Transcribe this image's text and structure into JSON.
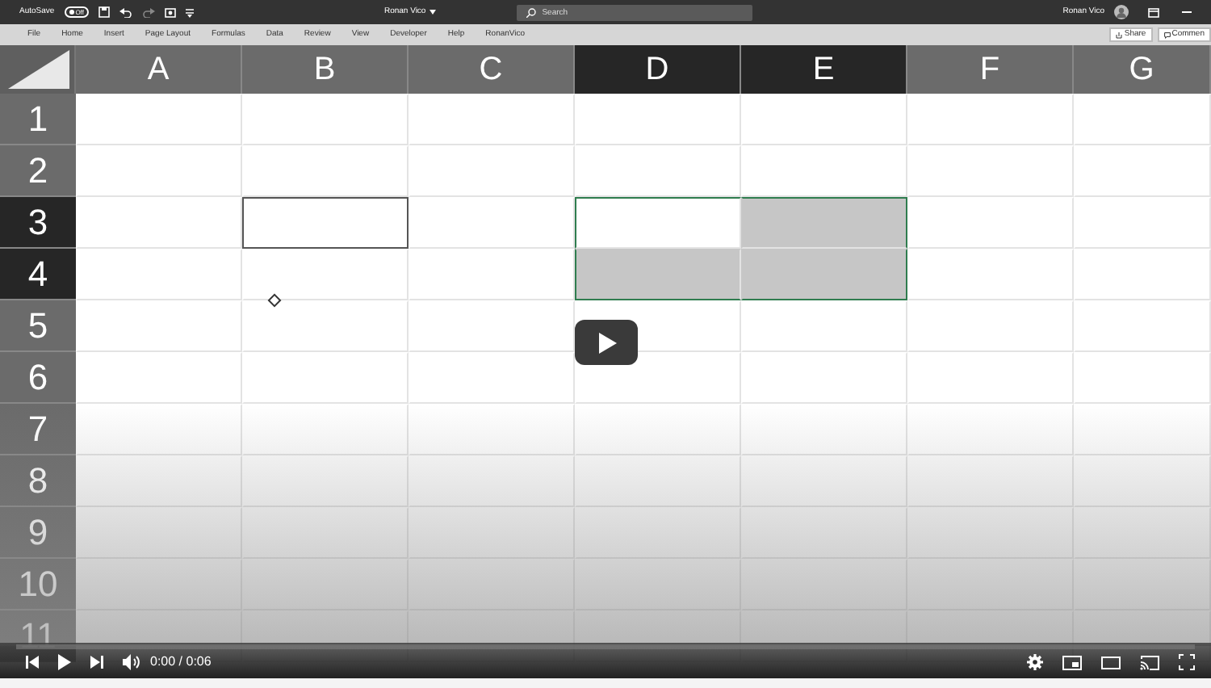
{
  "title_bar": {
    "autosave_label": "AutoSave",
    "autosave_state": "Off",
    "autosave_on": false,
    "document_title": "Ronan Vico",
    "search_placeholder": "Search",
    "user_name": "Ronan Vico"
  },
  "ribbon_tabs": [
    {
      "label": "File",
      "selected": false
    },
    {
      "label": "Home",
      "selected": false
    },
    {
      "label": "Insert",
      "selected": false
    },
    {
      "label": "Page Layout",
      "selected": false
    },
    {
      "label": "Formulas",
      "selected": false
    },
    {
      "label": "Data",
      "selected": false
    },
    {
      "label": "Review",
      "selected": false
    },
    {
      "label": "View",
      "selected": false
    },
    {
      "label": "Developer",
      "selected": false
    },
    {
      "label": "Help",
      "selected": false
    },
    {
      "label": "RonanVico",
      "selected": false
    }
  ],
  "ribbon_buttons": [
    "Share",
    "Commen"
  ],
  "columns": [
    {
      "label": "A",
      "selected": false
    },
    {
      "label": "B",
      "selected": false
    },
    {
      "label": "C",
      "selected": false
    },
    {
      "label": "D",
      "selected": true
    },
    {
      "label": "E",
      "selected": true
    },
    {
      "label": "F",
      "selected": false
    },
    {
      "label": "G",
      "selected": false
    }
  ],
  "rows": [
    {
      "label": "1",
      "selected": false,
      "cells": [
        {
          "selected": false,
          "active": false,
          "bordered": false
        },
        {
          "selected": false,
          "active": false,
          "bordered": false
        },
        {
          "selected": false,
          "active": false,
          "bordered": false
        },
        {
          "selected": false,
          "active": false,
          "bordered": false
        },
        {
          "selected": false,
          "active": false,
          "bordered": false
        },
        {
          "selected": false,
          "active": false,
          "bordered": false
        },
        {
          "selected": false,
          "active": false,
          "bordered": false
        }
      ]
    },
    {
      "label": "2",
      "selected": false,
      "cells": [
        {
          "selected": false,
          "active": false,
          "bordered": false
        },
        {
          "selected": false,
          "active": false,
          "bordered": false
        },
        {
          "selected": false,
          "active": false,
          "bordered": false
        },
        {
          "selected": false,
          "active": false,
          "bordered": false
        },
        {
          "selected": false,
          "active": false,
          "bordered": false
        },
        {
          "selected": false,
          "active": false,
          "bordered": false
        },
        {
          "selected": false,
          "active": false,
          "bordered": false
        }
      ]
    },
    {
      "label": "3",
      "selected": true,
      "cells": [
        {
          "selected": false,
          "active": false,
          "bordered": false
        },
        {
          "selected": false,
          "active": false,
          "bordered": true
        },
        {
          "selected": false,
          "active": false,
          "bordered": false
        },
        {
          "selected": true,
          "active": true,
          "bordered": false
        },
        {
          "selected": true,
          "active": false,
          "bordered": false
        },
        {
          "selected": false,
          "active": false,
          "bordered": false
        },
        {
          "selected": false,
          "active": false,
          "bordered": false
        }
      ]
    },
    {
      "label": "4",
      "selected": true,
      "cells": [
        {
          "selected": false,
          "active": false,
          "bordered": false
        },
        {
          "selected": false,
          "active": false,
          "bordered": false
        },
        {
          "selected": false,
          "active": false,
          "bordered": false
        },
        {
          "selected": true,
          "active": false,
          "bordered": false
        },
        {
          "selected": true,
          "active": false,
          "bordered": false
        },
        {
          "selected": false,
          "active": false,
          "bordered": false
        },
        {
          "selected": false,
          "active": false,
          "bordered": false
        }
      ]
    },
    {
      "label": "5",
      "selected": false,
      "cells": [
        {
          "selected": false,
          "active": false,
          "bordered": false
        },
        {
          "selected": false,
          "active": false,
          "bordered": false
        },
        {
          "selected": false,
          "active": false,
          "bordered": false
        },
        {
          "selected": false,
          "active": false,
          "bordered": false
        },
        {
          "selected": false,
          "active": false,
          "bordered": false
        },
        {
          "selected": false,
          "active": false,
          "bordered": false
        },
        {
          "selected": false,
          "active": false,
          "bordered": false
        }
      ]
    },
    {
      "label": "6",
      "selected": false,
      "cells": [
        {
          "selected": false,
          "active": false,
          "bordered": false
        },
        {
          "selected": false,
          "active": false,
          "bordered": false
        },
        {
          "selected": false,
          "active": false,
          "bordered": false
        },
        {
          "selected": false,
          "active": false,
          "bordered": false
        },
        {
          "selected": false,
          "active": false,
          "bordered": false
        },
        {
          "selected": false,
          "active": false,
          "bordered": false
        },
        {
          "selected": false,
          "active": false,
          "bordered": false
        }
      ]
    },
    {
      "label": "7",
      "selected": false,
      "cells": [
        {
          "selected": false,
          "active": false,
          "bordered": false
        },
        {
          "selected": false,
          "active": false,
          "bordered": false
        },
        {
          "selected": false,
          "active": false,
          "bordered": false
        },
        {
          "selected": false,
          "active": false,
          "bordered": false
        },
        {
          "selected": false,
          "active": false,
          "bordered": false
        },
        {
          "selected": false,
          "active": false,
          "bordered": false
        },
        {
          "selected": false,
          "active": false,
          "bordered": false
        }
      ]
    },
    {
      "label": "8",
      "selected": false,
      "cells": [
        {
          "selected": false,
          "active": false,
          "bordered": false
        },
        {
          "selected": false,
          "active": false,
          "bordered": false
        },
        {
          "selected": false,
          "active": false,
          "bordered": false
        },
        {
          "selected": false,
          "active": false,
          "bordered": false
        },
        {
          "selected": false,
          "active": false,
          "bordered": false
        },
        {
          "selected": false,
          "active": false,
          "bordered": false
        },
        {
          "selected": false,
          "active": false,
          "bordered": false
        }
      ]
    },
    {
      "label": "9",
      "selected": false,
      "cells": [
        {
          "selected": false,
          "active": false,
          "bordered": false
        },
        {
          "selected": false,
          "active": false,
          "bordered": false
        },
        {
          "selected": false,
          "active": false,
          "bordered": false
        },
        {
          "selected": false,
          "active": false,
          "bordered": false
        },
        {
          "selected": false,
          "active": false,
          "bordered": false
        },
        {
          "selected": false,
          "active": false,
          "bordered": false
        },
        {
          "selected": false,
          "active": false,
          "bordered": false
        }
      ]
    },
    {
      "label": "10",
      "selected": false,
      "cells": [
        {
          "selected": false,
          "active": false,
          "bordered": false
        },
        {
          "selected": false,
          "active": false,
          "bordered": false
        },
        {
          "selected": false,
          "active": false,
          "bordered": false
        },
        {
          "selected": false,
          "active": false,
          "bordered": false
        },
        {
          "selected": false,
          "active": false,
          "bordered": false
        },
        {
          "selected": false,
          "active": false,
          "bordered": false
        },
        {
          "selected": false,
          "active": false,
          "bordered": false
        }
      ]
    },
    {
      "label": "11",
      "selected": false
    }
  ],
  "player": {
    "time": "0:00 / 0:06",
    "level": 0,
    "playing": false
  }
}
